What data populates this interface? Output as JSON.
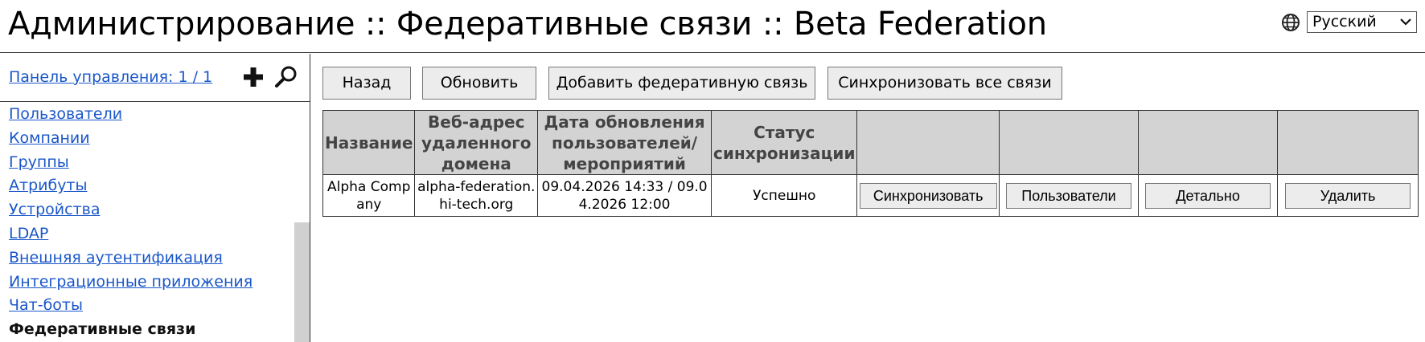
{
  "header": {
    "title": "Администрирование :: Федеративные связи :: Beta Federation",
    "language": "Русский",
    "globe_icon": "globe-icon",
    "chevron_icon": "chevron-down-icon"
  },
  "sidebar": {
    "dashboard_link": "Панель управления: 1 / 1",
    "add_icon": "plus-icon",
    "search_icon": "search-icon",
    "items": [
      {
        "label": "Пользователи",
        "active": false
      },
      {
        "label": "Компании",
        "active": false
      },
      {
        "label": "Группы",
        "active": false
      },
      {
        "label": "Атрибуты",
        "active": false
      },
      {
        "label": "Устройства",
        "active": false
      },
      {
        "label": "LDAP",
        "active": false
      },
      {
        "label": "Внешняя аутентификация",
        "active": false
      },
      {
        "label": "Интеграционные приложения",
        "active": false
      },
      {
        "label": "Чат-боты",
        "active": false
      },
      {
        "label": "Федеративные связи",
        "active": true
      }
    ]
  },
  "toolbar": {
    "back": "Назад",
    "refresh": "Обновить",
    "add": "Добавить федеративную связь",
    "sync_all": "Синхронизовать все связи"
  },
  "table": {
    "headers": {
      "name": "Название",
      "url": "Веб-адрес удаленного домена",
      "updated": "Дата обновления пользователей/ мероприятий",
      "status": "Статус синхронизации"
    },
    "rows": [
      {
        "name": "Alpha Company",
        "url": "alpha-federation.hi-tech.org",
        "updated": "09.04.2026 14:33 / 09.04.2026 12:00",
        "status": "Успешно",
        "sync_btn": "Синхронизовать",
        "users_btn": "Пользователи",
        "details_btn": "Детально",
        "delete_btn": "Удалить"
      }
    ]
  }
}
